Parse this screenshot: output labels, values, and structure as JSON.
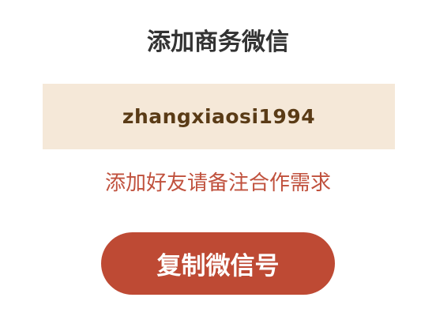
{
  "dialog": {
    "title": "添加商务微信",
    "wechat_id": "zhangxiaosi1994",
    "note": "添加好友请备注合作需求",
    "copy_button_label": "复制微信号"
  },
  "colors": {
    "id_box_background": "#f5e8d8",
    "accent": "#be4a34",
    "note_text": "#c0513d"
  }
}
